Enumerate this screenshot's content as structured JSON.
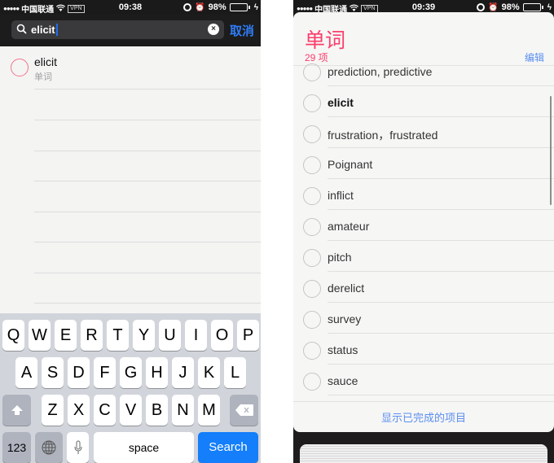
{
  "left": {
    "status_bar": {
      "signal": "●●●●●",
      "carrier": "中国联通",
      "wifi_icon": "wifi-icon",
      "vpn": "VPN",
      "time": "09:38",
      "battery": "98%",
      "battery_level": 0.98,
      "charging": "ϟ",
      "alarm": "⏰"
    },
    "search": {
      "value": "elicit",
      "clear_label": "×",
      "cancel_label": "取消"
    },
    "results": [
      {
        "title": "elicit",
        "list": "单词"
      }
    ],
    "keyboard": {
      "row1": [
        "Q",
        "W",
        "E",
        "R",
        "T",
        "Y",
        "U",
        "I",
        "O",
        "P"
      ],
      "row2": [
        "A",
        "S",
        "D",
        "F",
        "G",
        "H",
        "J",
        "K",
        "L"
      ],
      "row3": [
        "Z",
        "X",
        "C",
        "V",
        "B",
        "N",
        "M"
      ],
      "shift": "⇧",
      "delete": "⌫",
      "numbers": "123",
      "globe": "globe",
      "mic": "mic",
      "space": "space",
      "search": "Search"
    }
  },
  "right": {
    "status_bar": {
      "signal": "●●●●●",
      "carrier": "中国联通",
      "vpn": "VPN",
      "time": "09:39",
      "battery": "98%",
      "battery_level": 0.98,
      "charging": "ϟ",
      "alarm": "⏰"
    },
    "list": {
      "title": "单词",
      "count": "29 项",
      "edit_label": "编辑",
      "items": [
        {
          "label": "prediction, predictive",
          "bold": false
        },
        {
          "label": "elicit",
          "bold": true
        },
        {
          "label": "frustration，frustrated",
          "bold": false
        },
        {
          "label": "Poignant",
          "bold": false
        },
        {
          "label": "inflict",
          "bold": false
        },
        {
          "label": "amateur",
          "bold": false
        },
        {
          "label": "pitch",
          "bold": false
        },
        {
          "label": "derelict",
          "bold": false
        },
        {
          "label": "survey",
          "bold": false
        },
        {
          "label": "status",
          "bold": false
        },
        {
          "label": "sauce",
          "bold": false
        }
      ],
      "show_completed_label": "显示已完成的项目"
    }
  },
  "colors": {
    "accent_red": "#fa3e6b",
    "link_blue": "#5b8ff0",
    "search_blue": "#147efb",
    "battery_green": "#4cd964"
  }
}
